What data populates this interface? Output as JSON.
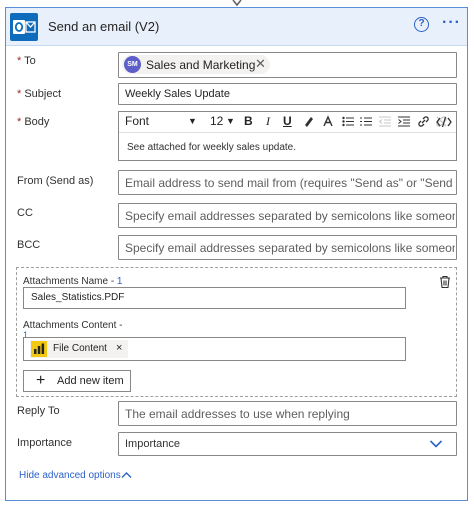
{
  "header": {
    "title": "Send an email (V2)",
    "help_icon": "question-circle-icon",
    "more_label": "···"
  },
  "fields": {
    "to": {
      "label": "To",
      "required_mark": "*",
      "token": {
        "initials": "SM",
        "label": "Sales and Marketing",
        "remove": "✕"
      }
    },
    "subject": {
      "label": "Subject",
      "required_mark": "*",
      "value": "Weekly Sales Update"
    },
    "body": {
      "label": "Body",
      "required_mark": "*",
      "toolbar": {
        "font": "Font",
        "size": "12",
        "bold": "B",
        "italic": "I",
        "underline": "U"
      },
      "value": "See attached for weekly sales update."
    },
    "from": {
      "label": "From (Send as)",
      "placeholder": "Email address to send mail from (requires \"Send as\" or \"Send on beh"
    },
    "cc": {
      "label": "CC",
      "placeholder": "Specify email addresses separated by semicolons like someone@con"
    },
    "bcc": {
      "label": "BCC",
      "placeholder": "Specify email addresses separated by semicolons like someone@con"
    }
  },
  "attachments": {
    "name_label": "Attachments Name - ",
    "name_index": "1",
    "name_value": "Sales_Statistics.PDF",
    "content_label": "Attachments Content -",
    "content_index": "1",
    "content_chip": "File Content",
    "content_remove": "×",
    "add_button": "Add new item",
    "add_plus": "+"
  },
  "reply_to": {
    "label": "Reply To",
    "placeholder": "The email addresses to use when replying"
  },
  "importance": {
    "label": "Importance",
    "value": "Importance"
  },
  "footer": {
    "link": "Hide advanced options",
    "chevron": "^"
  },
  "colors": {
    "accent": "#2b62c9",
    "outlook": "#0f6cbd",
    "required": "#a4262c",
    "powerbi": "#f2c811"
  }
}
